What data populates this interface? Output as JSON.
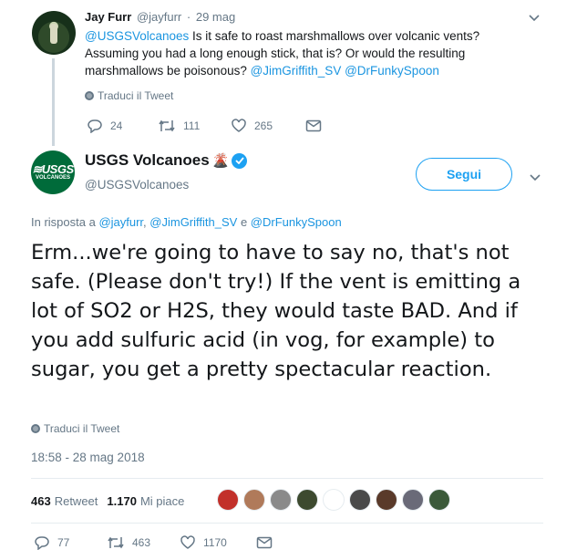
{
  "reply_tweet": {
    "name": "Jay Furr",
    "handle": "@jayfurr",
    "separator": "·",
    "date": "29 mag",
    "text_parts": [
      {
        "t": "@USGSVolcanoes",
        "link": true
      },
      {
        "t": " Is it safe to roast marshmallows over volcanic vents? Assuming you had a long enough stick, that is?  Or would the resulting marshmallows be poisonous?  ",
        "link": false
      },
      {
        "t": "@JimGriffith_SV",
        "link": true
      },
      {
        "t": " ",
        "link": false
      },
      {
        "t": "@DrFunkySpoon",
        "link": true
      }
    ],
    "translate_label": "Traduci il Tweet",
    "reply_count": "24",
    "retweet_count": "111",
    "like_count": "265"
  },
  "main_tweet": {
    "avatar_logo": "≋USGS",
    "avatar_sub": "VOLCANOES",
    "name": "USGS Volcanoes",
    "name_emoji": "🌋",
    "handle": "@USGSVolcanoes",
    "follow_label": "Segui",
    "in_reply_prefix": "In risposta a ",
    "in_reply_users": [
      "@jayfurr",
      "@JimGriffith_SV",
      "@DrFunkySpoon"
    ],
    "in_reply_comma": ", ",
    "in_reply_and": " e ",
    "text": "Erm...we're going to have to say no, that's not safe. (Please don't try!) If the vent is emitting a lot of SO2 or H2S, they would taste BAD. And if you add sulfuric acid (in vog, for example) to sugar, you get a pretty spectacular reaction.",
    "translate_label": "Traduci il Tweet",
    "timestamp": "18:58 - 28 mag 2018",
    "retweet_stat_value": "463",
    "retweet_stat_label": "Retweet",
    "like_stat_value": "1.170",
    "like_stat_label": "Mi piace",
    "reply_count": "77",
    "retweet_count": "463",
    "like_count": "1170"
  },
  "likers": [
    {
      "name": "liker-1",
      "color": "#c2302a"
    },
    {
      "name": "liker-2",
      "color": "#b07a5a"
    },
    {
      "name": "liker-3",
      "color": "#8a8a8a"
    },
    {
      "name": "liker-4",
      "color": "#3d4a2f"
    },
    {
      "name": "liker-5",
      "color": "#ffffff"
    },
    {
      "name": "liker-6",
      "color": "#4a4a4a"
    },
    {
      "name": "liker-7",
      "color": "#5a3a2a"
    },
    {
      "name": "liker-8",
      "color": "#6a6a78"
    },
    {
      "name": "liker-9",
      "color": "#3b5a3a"
    }
  ],
  "colors": {
    "link": "#1b95e0",
    "muted": "#657786",
    "accent": "#1da1f2",
    "usgs_green": "#006b3a"
  },
  "icons": [
    "caret-down-icon",
    "globe-icon",
    "reply-icon",
    "retweet-icon",
    "like-icon",
    "dm-icon",
    "verified-icon"
  ]
}
